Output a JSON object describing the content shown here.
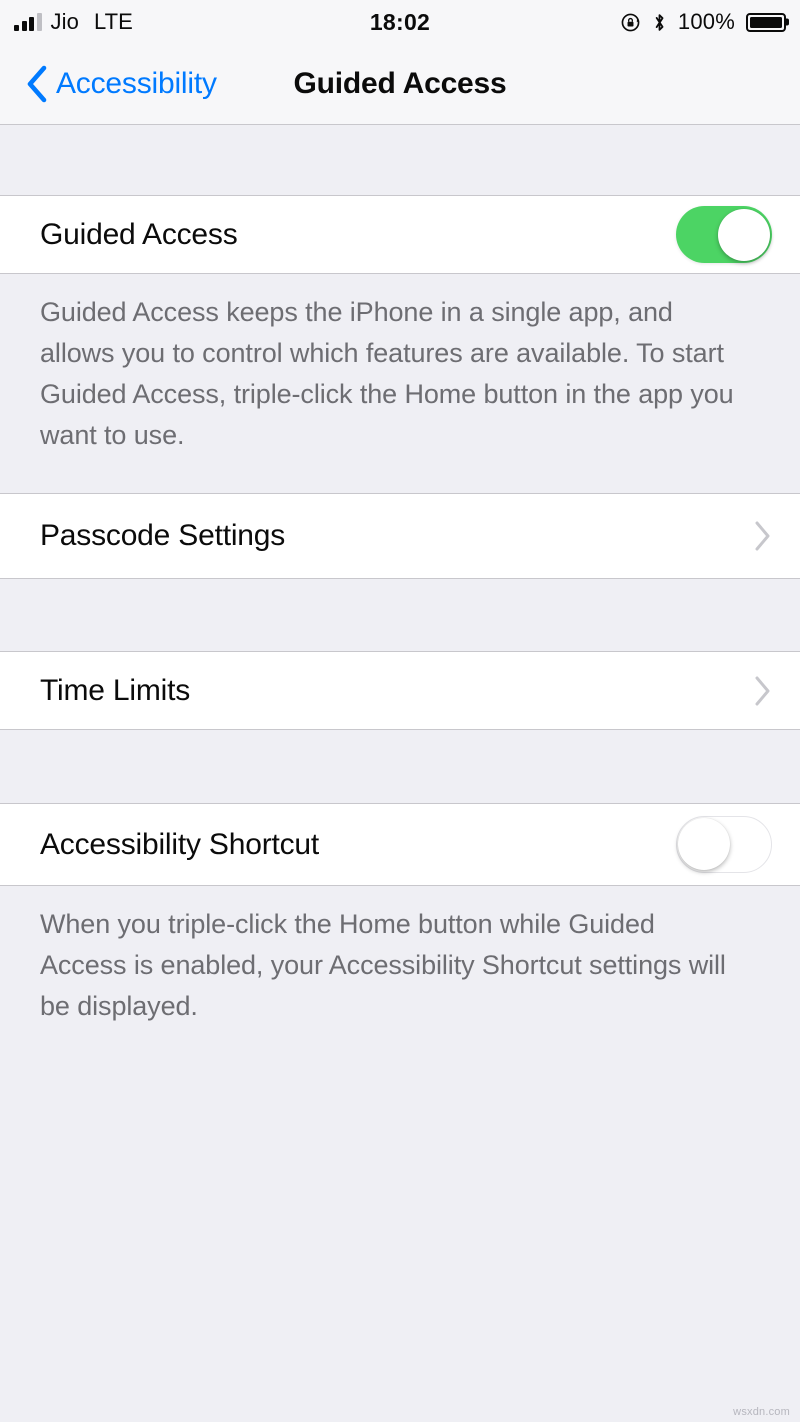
{
  "status_bar": {
    "carrier": "Jio",
    "radio": "LTE",
    "time": "18:02",
    "battery_percent": "100%",
    "signal_bars_filled": 3,
    "signal_bars_total": 4,
    "icons": [
      "rotation-lock-icon",
      "bluetooth-icon",
      "battery-icon"
    ]
  },
  "nav_bar": {
    "back_label": "Accessibility",
    "title": "Guided Access"
  },
  "sections": {
    "guided_access": {
      "label": "Guided Access",
      "toggle_state": "on",
      "footer": "Guided Access keeps the iPhone in a single app, and allows you to control which features are available. To start Guided Access, triple-click the Home button in the app you want to use."
    },
    "passcode_settings": {
      "label": "Passcode Settings"
    },
    "time_limits": {
      "label": "Time Limits"
    },
    "accessibility_shortcut": {
      "label": "Accessibility Shortcut",
      "toggle_state": "off",
      "footer": "When you triple-click the Home button while Guided Access is enabled, your Accessibility Shortcut settings will be displayed."
    }
  },
  "watermark": "wsxdn.com",
  "colors": {
    "accent_blue": "#007AFF",
    "toggle_on_green": "#4CD464",
    "background": "#EFEFF4",
    "cell_background": "#FFFFFF",
    "separator": "#C8C7CC",
    "footer_text": "#6D6D72"
  }
}
